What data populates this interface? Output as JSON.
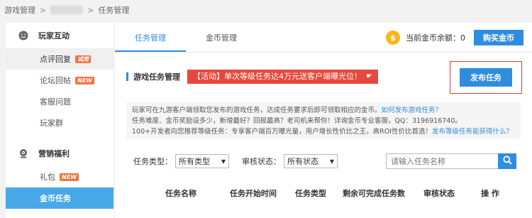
{
  "breadcrumb": {
    "root": "游戏管理",
    "separator": ">",
    "current": "任务管理"
  },
  "sidebar": {
    "groups": [
      {
        "title": "玩家互动",
        "icon": "smiley-icon",
        "items": [
          {
            "label": "点评回复",
            "badge": "试用"
          },
          {
            "label": "论坛回帖",
            "badge": "NEW"
          },
          {
            "label": "客服问题",
            "badge": ""
          },
          {
            "label": "玩家群",
            "badge": ""
          }
        ]
      },
      {
        "title": "营销福利",
        "icon": "webcam-icon",
        "items": [
          {
            "label": "礼包",
            "badge": "NEW"
          },
          {
            "label": "金币任务",
            "badge": ""
          }
        ]
      }
    ]
  },
  "tabs": [
    {
      "label": "任务管理",
      "active": true
    },
    {
      "label": "金币管理",
      "active": false
    }
  ],
  "coins": {
    "icon_glyph": "$",
    "label": "当前金币余额：0",
    "buy_label": "购买金币"
  },
  "section": {
    "title": "游戏任务管理",
    "promo": "【活动】单次等级任务达4万元送客户端曝光位！",
    "publish_label": "发布任务"
  },
  "info": {
    "line1_text": "玩家可在九游客户端领取您发布的游戏任务，达成任务要求后即可领取相应的金币。",
    "line1_link": "如何发布游戏任务？",
    "line2_text": "任务难度、金币奖励设多少，新增最好？回报最高？老司机来帮你！详询金币专业客服，QQ：3196916740。",
    "line3_text": "100+开发者向您推荐等级任务：专享客户端百万曝光量，用户增长性价比之王，高ROI性价比首选！",
    "line3_link": "发布等级任务能获得什么？"
  },
  "filters": {
    "type_label": "任务类型：",
    "type_value": "所有类型",
    "status_label": "审核状态：",
    "status_value": "所有状态",
    "search_placeholder": "请输入任务名称"
  },
  "table": {
    "columns": [
      "任务名称",
      "任务开始时间",
      "任务类型",
      "剩余可完成任务数",
      "审核状态",
      "操 作"
    ]
  },
  "colors": {
    "accent": "#2f8de0",
    "sidebar_selected": "#48a8e8",
    "promo": "#e8473d",
    "badge": "#f3743f",
    "coin": "#f6b81d"
  }
}
